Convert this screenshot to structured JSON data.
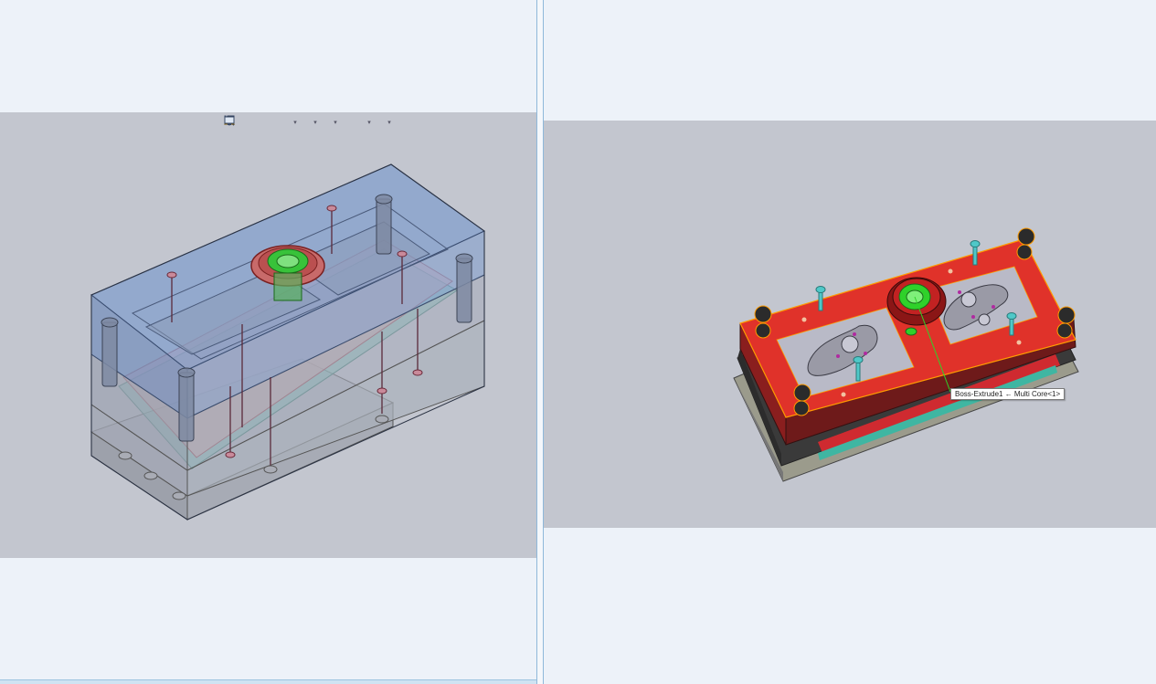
{
  "left_view": {
    "toolbar": {
      "buttons": [
        {
          "name": "zoom-to-fit-icon"
        },
        {
          "name": "zoom-to-area-icon"
        },
        {
          "name": "previous-view-icon"
        },
        {
          "name": "section-view-icon"
        },
        {
          "name": "dynamic-annotation-icon"
        },
        {
          "name": "view-orientation-icon"
        },
        {
          "name": "display-style-icon"
        },
        {
          "name": "hide-show-items-icon"
        },
        {
          "name": "edit-appearance-icon"
        },
        {
          "name": "apply-scene-icon"
        },
        {
          "name": "view-settings-icon"
        }
      ]
    },
    "display_mode": "transparent",
    "colors": {
      "background": "#c3c6cf",
      "clamp_plate": "#7f9ccc",
      "cavity_highlight": "#e6a0a8",
      "core_plate_teal": "#6fc1b0",
      "selection_green": "#38c23a"
    }
  },
  "right_view": {
    "tooltip": "Boss-Extrude1 ← Multi Core<1>",
    "display_mode": "shaded",
    "colors": {
      "background": "#c3c6cf",
      "top_plate": "#e0322a",
      "selection_outline": "#ff9b00",
      "bolt_teal": "#4fc8c8",
      "sprue_green": "#2fd12a",
      "cavity_insert": "#b9bac7"
    }
  }
}
